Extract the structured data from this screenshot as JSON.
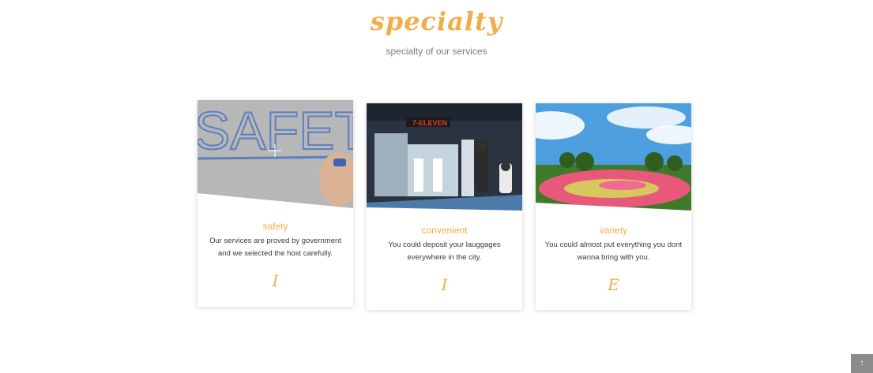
{
  "section": {
    "title": "specialty",
    "subtitle": "specialty of our services"
  },
  "cards": [
    {
      "title": "safety",
      "text": "Our services are proved by government and we selected the host carefully.",
      "mark": "I",
      "image_text": "SAFETY"
    },
    {
      "title": "convenient",
      "text": "You could deposit your lauggages everywhere in the city.",
      "mark": "I",
      "image_text": "7-ELEVEN"
    },
    {
      "title": "variety",
      "text": "You could almost put everything you dont wanna bring with you.",
      "mark": "E"
    }
  ],
  "scroll_top": {
    "icon": "arrow-up-icon",
    "label": "↑"
  },
  "colors": {
    "accent": "#f0ae4a"
  }
}
